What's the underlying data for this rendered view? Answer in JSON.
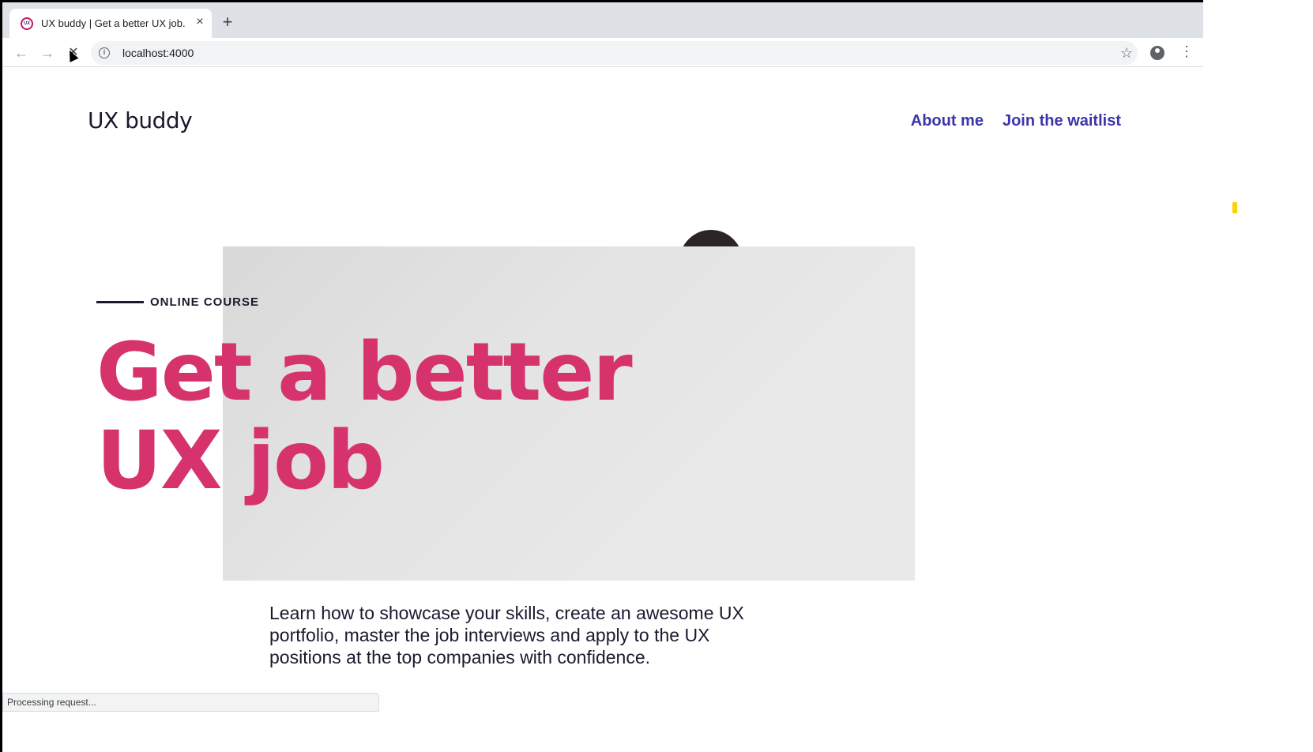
{
  "browser": {
    "tab": {
      "title": "UX buddy | Get a better UX job.",
      "favicon": "ux-buddy-favicon",
      "close_glyph": "×"
    },
    "new_tab_glyph": "+",
    "toolbar": {
      "back_glyph": "←",
      "forward_glyph": "→",
      "stop_glyph": "✕",
      "url": "localhost:4000",
      "info_glyph": "i",
      "star_glyph": "☆",
      "menu_glyph": "⋮"
    },
    "status": "Processing request..."
  },
  "site": {
    "logo": "UX buddy",
    "nav": [
      {
        "label": "About me"
      },
      {
        "label": "Join the waitlist"
      }
    ],
    "hero": {
      "eyebrow": "ONLINE COURSE",
      "headline_line1": "Get a better",
      "headline_line2": "UX job",
      "intro": "Learn how to showcase your skills, create an awesome UX portfolio, master the job interviews and apply to the UX positions at the top companies with confidence."
    }
  },
  "colors": {
    "accent": "#d6336c",
    "link": "#3b35a8",
    "text": "#1a1a2e"
  }
}
